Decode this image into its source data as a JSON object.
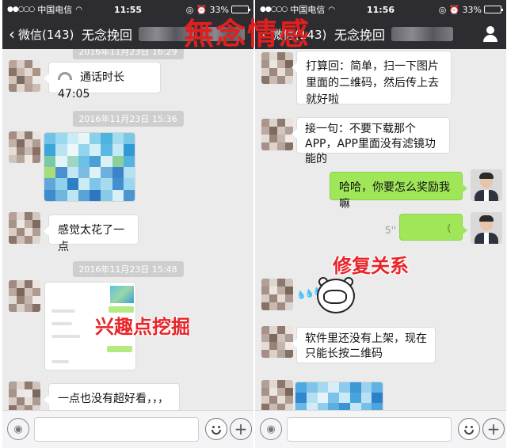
{
  "status_bar": {
    "signal": "●●○○○",
    "carrier": "中国电信",
    "wifi": "📶",
    "left_time": "11:55",
    "right_time": "11:56",
    "battery_text": "33%",
    "battery_level": 0.33,
    "icons_text": "◎ ⏰"
  },
  "nav": {
    "back_label": "微信(143)",
    "chat_title": "无念挽回"
  },
  "left_chat": {
    "ts1": "2016年11月23日 16:29",
    "call_text": "通话时长 47:05",
    "ts2": "2016年11月23日 15:36",
    "msg_blurry": "感觉太花了一点",
    "ts3": "2016年11月23日 15:48",
    "msg_not_pretty": "一点也没有超好看，，，"
  },
  "right_chat": {
    "msg_reply": "打算回：简单，扫一下图片里面的二维码，然后传上去就好啦",
    "msg_next": "接一句：不要下载那个APP，APP里面没有滤镜功能的",
    "msg_reward": "哈哈，你要怎么奖励我嘛",
    "voice_length": "5''",
    "msg_app": "软件里还没有上架，现在只能长按二维码"
  },
  "overlays": {
    "brand": "無念情感",
    "interest": "兴趣点挖掘",
    "repair": "修复关系"
  },
  "colors": {
    "nav_bg": "#2d2d31",
    "chat_bg": "#ebebeb",
    "green_bubble": "#9fe659",
    "overlay_red": "#e8242a"
  },
  "icons": [
    "back-chevron-icon",
    "person-icon",
    "phone-call-icon",
    "voice-wave-icon",
    "voice-toggle-icon",
    "emoji-icon",
    "plus-icon",
    "wifi-icon",
    "battery-icon"
  ]
}
